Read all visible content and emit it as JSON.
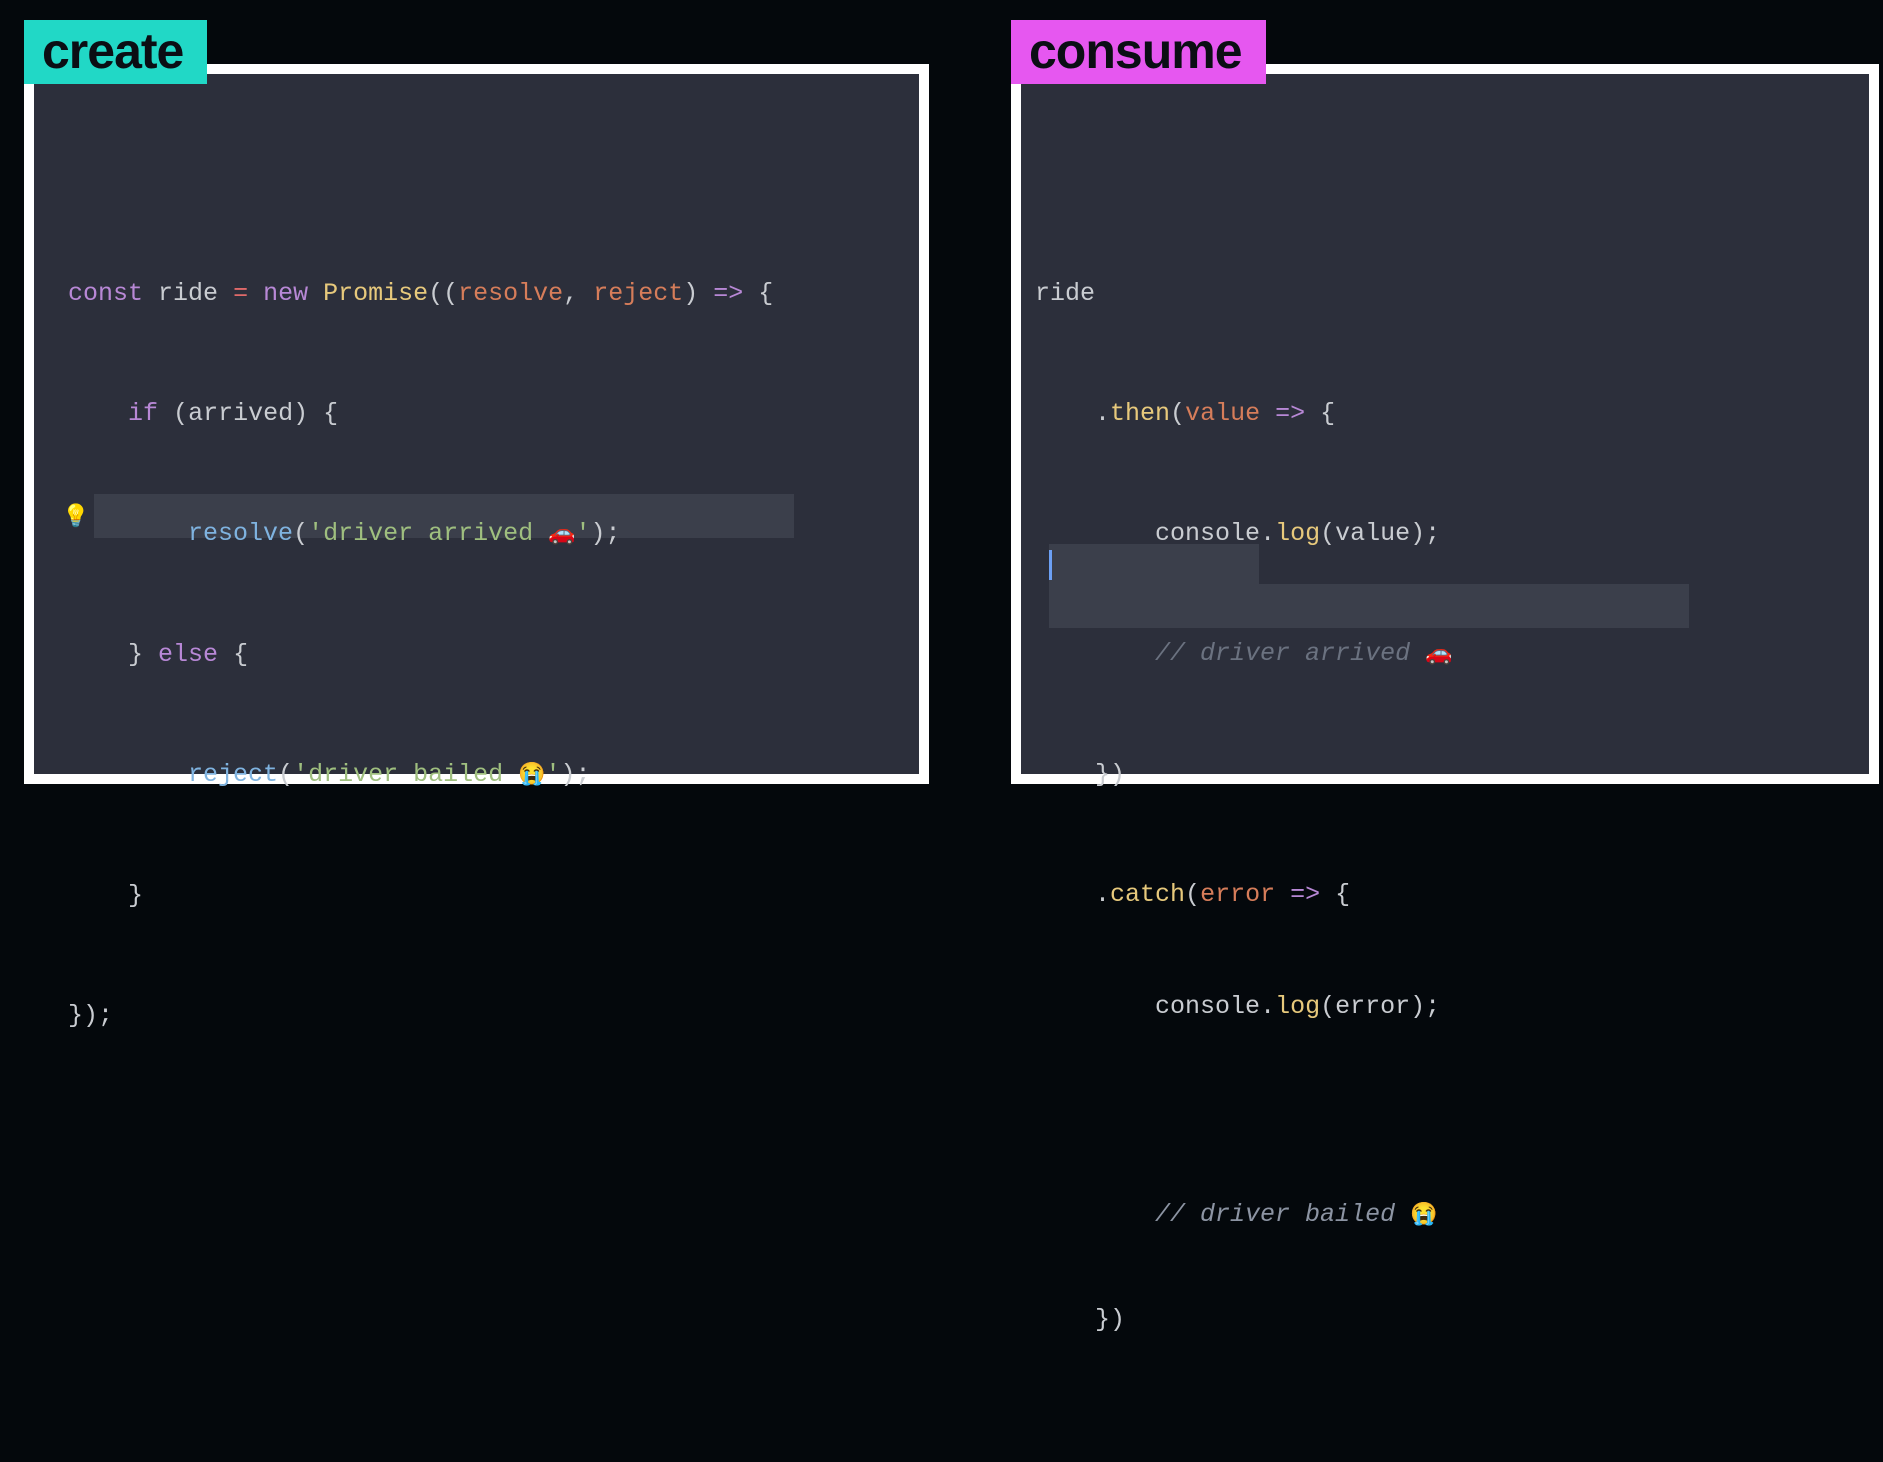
{
  "tabs": {
    "create": "create",
    "consume": "consume"
  },
  "create_code": {
    "l1": {
      "const": "const",
      "var": "ride",
      "eq": "=",
      "new": "new",
      "class": "Promise",
      "open": "((",
      "p1": "resolve",
      "comma": ", ",
      "p2": "reject",
      "close": ")",
      "arrow": "=>",
      "brace": "{"
    },
    "l2": {
      "if": "if",
      "open": "(",
      "cond": "arrived",
      "close": ")",
      "brace": "{"
    },
    "l3": {
      "fn": "resolve",
      "open": "(",
      "str": "'driver arrived ",
      "emoji": "🚗",
      "strend": "'",
      "close": ");"
    },
    "l4": {
      "brace": "}",
      "else": "else",
      "brace2": "{"
    },
    "l5": {
      "fn": "reject",
      "open": "(",
      "str": "'driver bailed ",
      "emoji": "😭",
      "strend": "'",
      "close": ");"
    },
    "l6": {
      "brace": "}"
    },
    "l7": {
      "close": "});"
    }
  },
  "consume_code": {
    "l1": {
      "var": "ride"
    },
    "l2": {
      "dot": ".",
      "method": "then",
      "open": "(",
      "param": "value",
      "arrow": "=>",
      "brace": "{"
    },
    "l3": {
      "obj": "console",
      "dot": ".",
      "method": "log",
      "open": "(",
      "arg": "value",
      "close": ");"
    },
    "l4": {
      "comment": "// driver arrived ",
      "emoji": "🚗"
    },
    "l5": {
      "brace": "})"
    },
    "l6": {
      "dot": ".",
      "method": "catch",
      "open": "(",
      "param": "error",
      "arrow": "=>",
      "brace": "{"
    },
    "l7": {
      "obj": "console",
      "dot": ".",
      "method": "log",
      "open": "(",
      "arg": "error",
      "close": ");"
    },
    "l8": {
      "comment": "// driver bailed ",
      "emoji": "😭"
    },
    "l9": {
      "brace": "})"
    }
  },
  "icons": {
    "bulb": "💡"
  }
}
